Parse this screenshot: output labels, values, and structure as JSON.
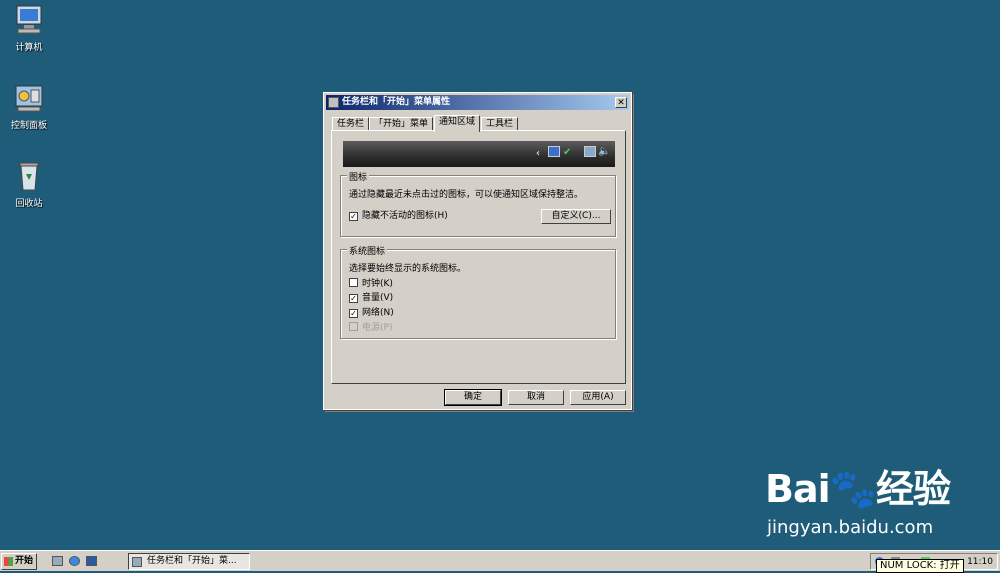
{
  "desktop": {
    "icons": [
      {
        "label": "计算机",
        "icon": "computer-icon"
      },
      {
        "label": "控制面板",
        "icon": "control-panel-icon"
      },
      {
        "label": "回收站",
        "icon": "recycle-bin-icon"
      }
    ]
  },
  "dialog": {
    "title": "任务栏和「开始」菜单属性",
    "close_label": "✕",
    "tabs": [
      {
        "label": "任务栏",
        "active": false
      },
      {
        "label": "「开始」菜单",
        "active": false
      },
      {
        "label": "通知区域",
        "active": true
      },
      {
        "label": "工具栏",
        "active": false
      }
    ],
    "icons_group": {
      "title": "图标",
      "description": "通过隐藏最近未点击过的图标，可以使通知区域保持整洁。",
      "hide_inactive": {
        "label": "隐藏不活动的图标(H)",
        "checked": true
      },
      "customize_button": "自定义(C)..."
    },
    "system_icons_group": {
      "title": "系统图标",
      "description": "选择要始终显示的系统图标。",
      "items": [
        {
          "label": "时钟(K)",
          "checked": false,
          "enabled": true
        },
        {
          "label": "音量(V)",
          "checked": true,
          "enabled": true
        },
        {
          "label": "网络(N)",
          "checked": true,
          "enabled": true
        },
        {
          "label": "电源(P)",
          "checked": false,
          "enabled": false
        }
      ]
    },
    "buttons": {
      "ok": "确定",
      "cancel": "取消",
      "apply": "应用(A)"
    }
  },
  "watermark": {
    "logo": "Bai🐾经验",
    "site": "jingyan.baidu.com"
  },
  "taskbar": {
    "start_label": "开始",
    "task_item": "任务栏和「开始」菜...",
    "clock": "11:10",
    "numlock_tip": "NUM LOCK: 打开"
  },
  "colors": {
    "desktop": "#1f5c7a",
    "title_start": "#0a246a",
    "title_end": "#a6caf0",
    "face": "#d4d0c8"
  }
}
